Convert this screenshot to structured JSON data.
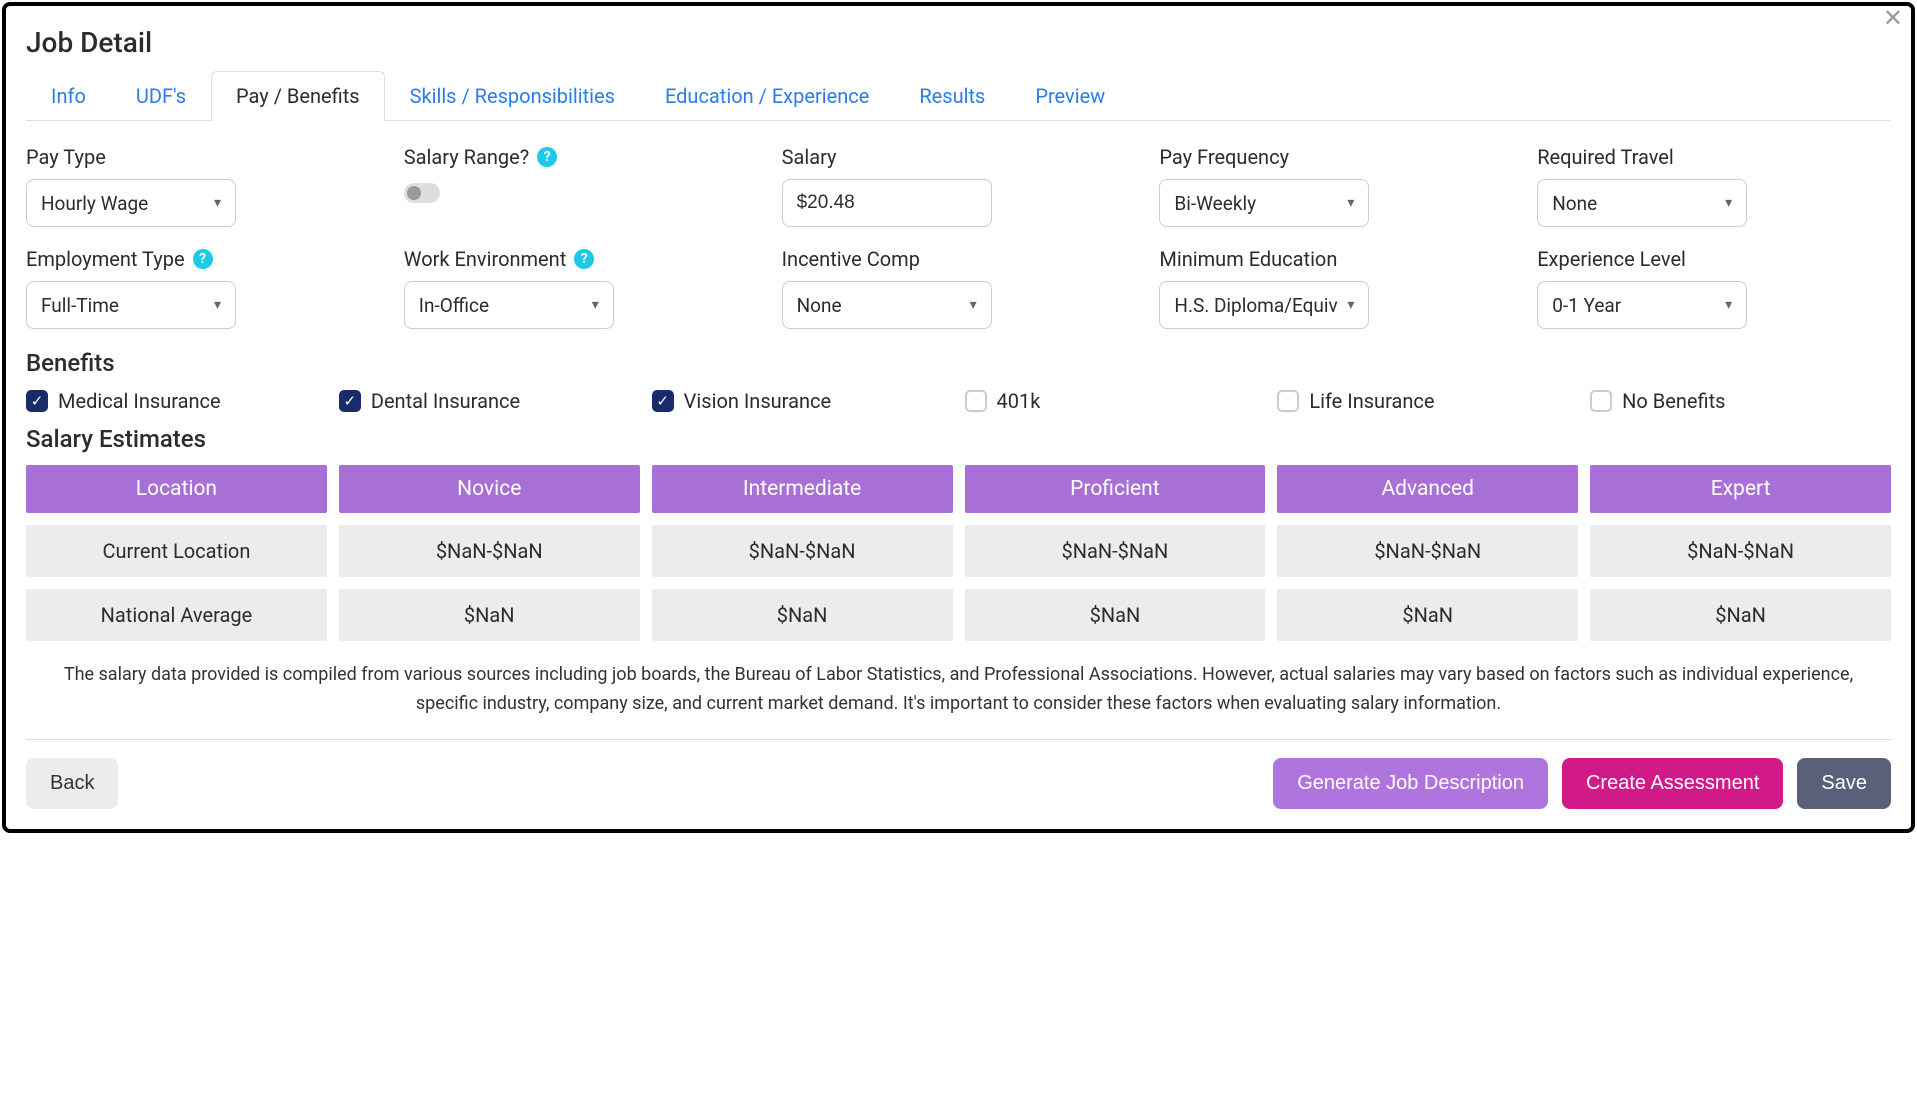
{
  "header": {
    "title": "Job Detail"
  },
  "tabs": [
    {
      "label": "Info",
      "active": false
    },
    {
      "label": "UDF's",
      "active": false
    },
    {
      "label": "Pay / Benefits",
      "active": true
    },
    {
      "label": "Skills / Responsibilities",
      "active": false
    },
    {
      "label": "Education / Experience",
      "active": false
    },
    {
      "label": "Results",
      "active": false
    },
    {
      "label": "Preview",
      "active": false
    }
  ],
  "fields": {
    "pay_type": {
      "label": "Pay Type",
      "value": "Hourly Wage"
    },
    "salary_range": {
      "label": "Salary Range?",
      "value": false
    },
    "salary": {
      "label": "Salary",
      "value": "$20.48"
    },
    "pay_frequency": {
      "label": "Pay Frequency",
      "value": "Bi-Weekly"
    },
    "required_travel": {
      "label": "Required Travel",
      "value": "None"
    },
    "employment_type": {
      "label": "Employment Type",
      "value": "Full-Time"
    },
    "work_environment": {
      "label": "Work Environment",
      "value": "In-Office"
    },
    "incentive_comp": {
      "label": "Incentive Comp",
      "value": "None"
    },
    "min_education": {
      "label": "Minimum Education",
      "value": "H.S. Diploma/Equiv"
    },
    "experience_level": {
      "label": "Experience Level",
      "value": "0-1 Year"
    }
  },
  "benefits": {
    "title": "Benefits",
    "items": [
      {
        "label": "Medical Insurance",
        "checked": true
      },
      {
        "label": "Dental Insurance",
        "checked": true
      },
      {
        "label": "Vision Insurance",
        "checked": true
      },
      {
        "label": "401k",
        "checked": false
      },
      {
        "label": "Life Insurance",
        "checked": false
      },
      {
        "label": "No Benefits",
        "checked": false
      }
    ]
  },
  "salary_estimates": {
    "title": "Salary Estimates",
    "headers": [
      "Location",
      "Novice",
      "Intermediate",
      "Proficient",
      "Advanced",
      "Expert"
    ],
    "rows": [
      {
        "label": "Current Location",
        "values": [
          "$NaN-$NaN",
          "$NaN-$NaN",
          "$NaN-$NaN",
          "$NaN-$NaN",
          "$NaN-$NaN"
        ]
      },
      {
        "label": "National Average",
        "values": [
          "$NaN",
          "$NaN",
          "$NaN",
          "$NaN",
          "$NaN"
        ]
      }
    ]
  },
  "disclaimer": "The salary data provided is compiled from various sources including job boards, the Bureau of Labor Statistics, and Professional Associations. However, actual salaries may vary based on factors such as individual experience, specific industry, company size, and current market demand. It's important to consider these factors when evaluating salary information.",
  "footer": {
    "back": "Back",
    "generate": "Generate Job Description",
    "assess": "Create Assessment",
    "save": "Save"
  }
}
